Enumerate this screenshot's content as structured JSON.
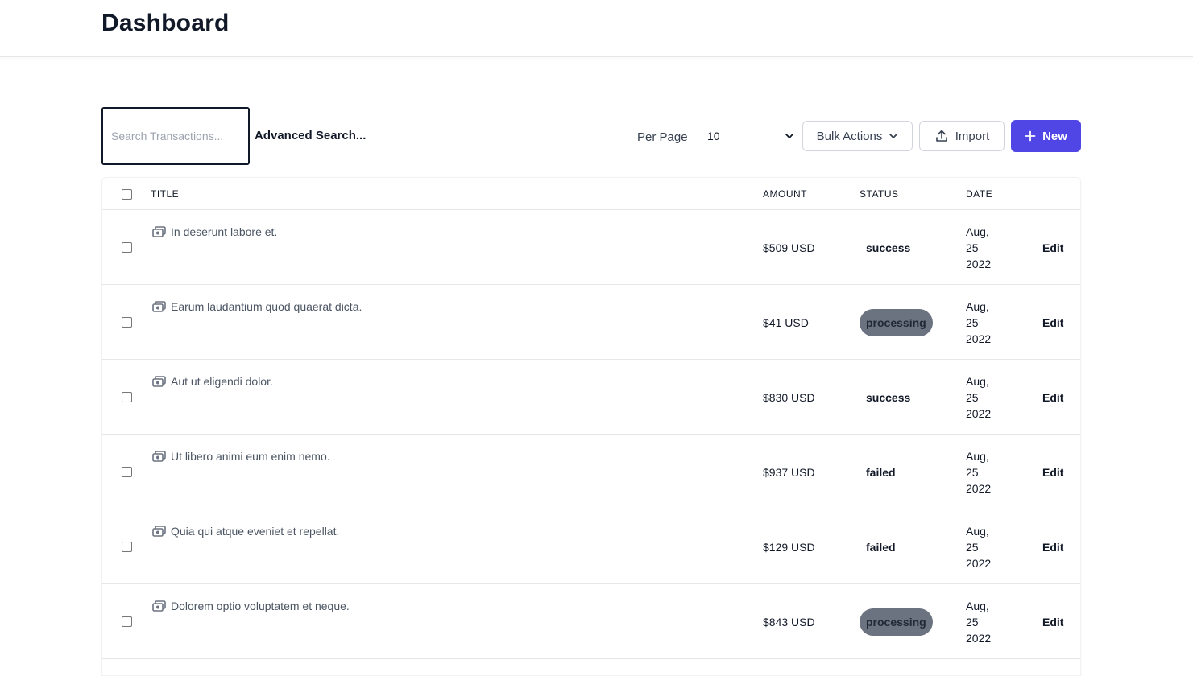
{
  "header": {
    "title": "Dashboard"
  },
  "toolbar": {
    "search_placeholder": "Search Transactions...",
    "advanced_search_label": "Advanced Search...",
    "per_page_label": "Per Page",
    "per_page_value": "10",
    "bulk_actions_label": "Bulk Actions",
    "import_label": "Import",
    "new_label": "New",
    "accent_color": "#4f46e5"
  },
  "table": {
    "columns": {
      "title": "TITLE",
      "amount": "AMOUNT",
      "status": "STATUS",
      "date": "DATE"
    },
    "rows": [
      {
        "title": "In deserunt labore et.",
        "amount": "$509 USD",
        "status": "success",
        "date_month": "Aug,",
        "date_day": "25",
        "date_year": "2022",
        "action": "Edit"
      },
      {
        "title": "Earum laudantium quod quaerat dicta.",
        "amount": "$41 USD",
        "status": "processing",
        "date_month": "Aug,",
        "date_day": "25",
        "date_year": "2022",
        "action": "Edit"
      },
      {
        "title": "Aut ut eligendi dolor.",
        "amount": "$830 USD",
        "status": "success",
        "date_month": "Aug,",
        "date_day": "25",
        "date_year": "2022",
        "action": "Edit"
      },
      {
        "title": "Ut libero animi eum enim nemo.",
        "amount": "$937 USD",
        "status": "failed",
        "date_month": "Aug,",
        "date_day": "25",
        "date_year": "2022",
        "action": "Edit"
      },
      {
        "title": "Quia qui atque eveniet et repellat.",
        "amount": "$129 USD",
        "status": "failed",
        "date_month": "Aug,",
        "date_day": "25",
        "date_year": "2022",
        "action": "Edit"
      },
      {
        "title": "Dolorem optio voluptatem et neque.",
        "amount": "$843 USD",
        "status": "processing",
        "date_month": "Aug,",
        "date_day": "25",
        "date_year": "2022",
        "action": "Edit"
      }
    ]
  },
  "icons": {
    "row_icon": "cash-icon",
    "import_icon": "upload-icon",
    "new_icon": "plus-icon",
    "dropdown_icon": "chevron-down-icon"
  },
  "status_colors": {
    "processing_badge": "#6b7280"
  }
}
